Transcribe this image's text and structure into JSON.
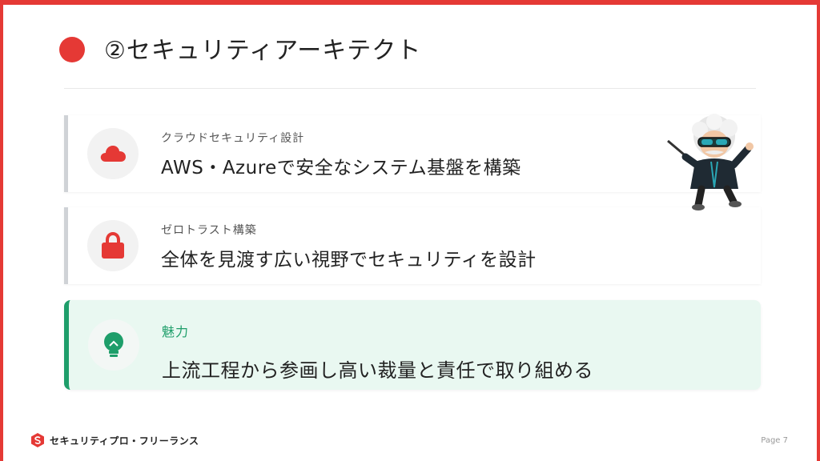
{
  "title": "②セキュリティアーキテクト",
  "cards": [
    {
      "icon": "cloud-icon",
      "subtitle": "クラウドセキュリティ設計",
      "text": "AWS・Azureで安全なシステム基盤を構築"
    },
    {
      "icon": "lock-icon",
      "subtitle": "ゼロトラスト構築",
      "text": "全体を見渡す広い視野でセキュリティを設計"
    },
    {
      "icon": "lightbulb-icon",
      "subtitle": "魅力",
      "text": "上流工程から参画し高い裁量と責任で取り組める"
    }
  ],
  "footer": {
    "brand": "セキュリティプロ・フリーランス",
    "page": "Page 7"
  },
  "colors": {
    "accent": "#e53935",
    "highlight": "#1e9e6a",
    "highlight_bg": "#e9f8f1"
  }
}
